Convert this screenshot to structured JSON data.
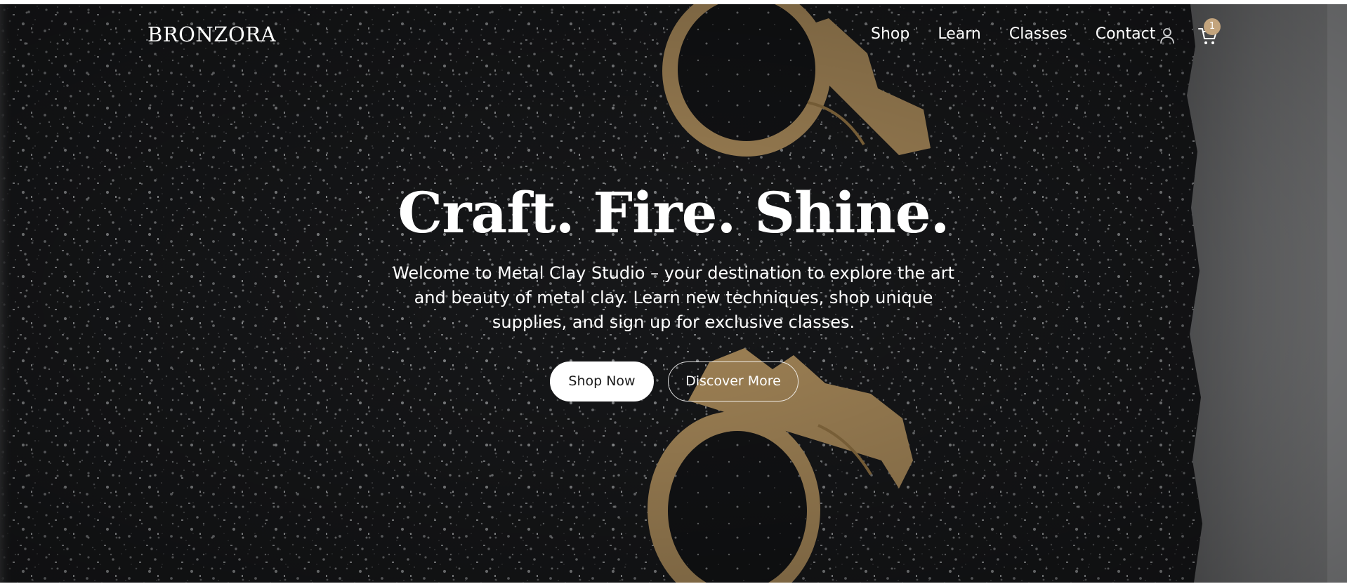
{
  "brand": {
    "logo_text": "BRONZORA"
  },
  "nav": {
    "items": [
      {
        "label": "Shop"
      },
      {
        "label": "Learn"
      },
      {
        "label": "Classes"
      },
      {
        "label": "Contact"
      }
    ]
  },
  "header_icons": {
    "account": "user-icon",
    "cart": "cart-icon",
    "cart_count": "1"
  },
  "hero": {
    "headline": "Craft. Fire. Shine.",
    "subtext": "Welcome to Metal Clay Studio – your destination to explore the art and beauty of metal clay. Learn new techniques, shop unique supplies, and sign up for exclusive classes.",
    "primary_button": "Shop Now",
    "secondary_button": "Discover More"
  },
  "colors": {
    "background": "#1b1c1e",
    "text": "#ffffff",
    "badge": "#c3a47d",
    "ring_clay": "#c9a46c"
  }
}
